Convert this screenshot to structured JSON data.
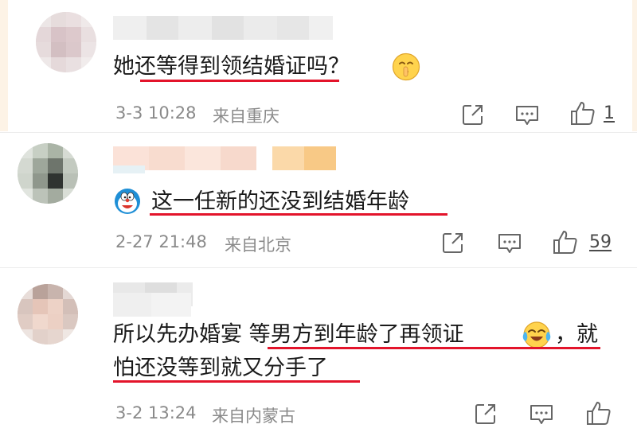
{
  "comments": [
    {
      "text": "她还等得到领结婚证吗？",
      "date": "3-3 10:28",
      "location": "来自重庆",
      "likes": "1"
    },
    {
      "text": "这一任新的还没到结婚年龄",
      "date": "2-27 21:48",
      "location": "来自北京",
      "likes": "59"
    },
    {
      "text_line1": "所以先办婚宴 等男方到年龄了再领证",
      "text_line1_tail": "，就",
      "text_line2": "怕还没等到就又分手了",
      "date": "3-2 13:24",
      "location": "来自内蒙古",
      "likes": ""
    }
  ],
  "colors": {
    "underline": "#e3142b",
    "meta_text": "#8a8a8a",
    "icon_stroke": "#666666"
  },
  "icons": [
    "share-icon",
    "reply-icon",
    "like-icon",
    "shush-emoji",
    "doraemon-emoji",
    "laugh-cry-emoji"
  ]
}
